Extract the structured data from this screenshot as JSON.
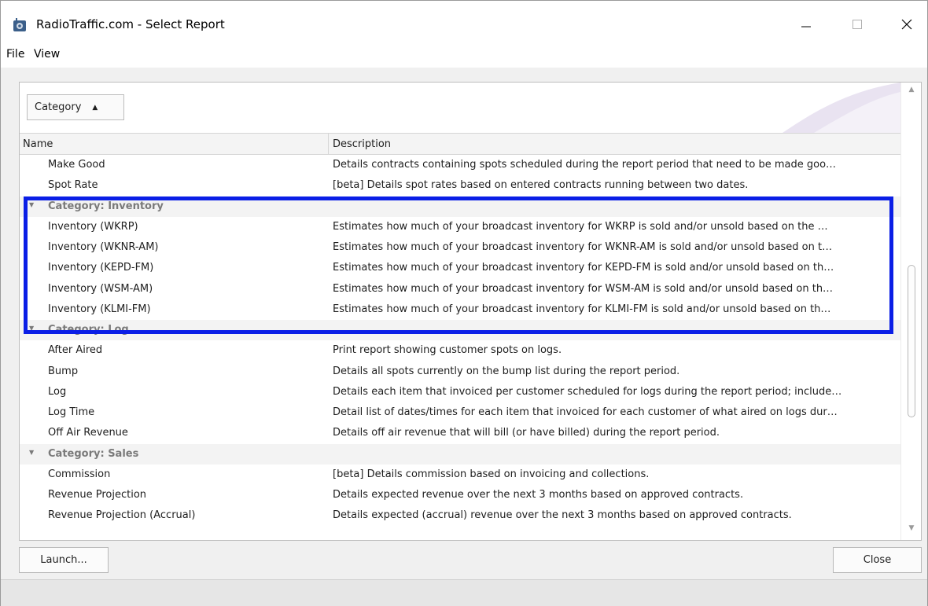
{
  "window": {
    "title": "RadioTraffic.com - Select Report",
    "app_icon": "radio-tower-icon"
  },
  "menu": {
    "file": "File",
    "view": "View"
  },
  "group_panel": {
    "chip_label": "Category",
    "chip_sort": "▲"
  },
  "columns": {
    "name": "Name",
    "description": "Description"
  },
  "rows": [
    {
      "name": "Make Good",
      "description": "Details contracts containing spots scheduled during the report period that need to be made goo…"
    },
    {
      "name": "Spot Rate",
      "description": "[beta] Details spot rates based on entered contracts running between two dates."
    }
  ],
  "groups": [
    {
      "label": "Category: Inventory",
      "rows": [
        {
          "name": "Inventory (WKRP)",
          "description": "Estimates how much of your broadcast inventory for WKRP is sold and/or unsold based on the …"
        },
        {
          "name": "Inventory (WKNR-AM)",
          "description": "Estimates how much of your broadcast inventory for WKNR-AM is sold and/or unsold based on t…"
        },
        {
          "name": "Inventory (KEPD-FM)",
          "description": "Estimates how much of your broadcast inventory for KEPD-FM is sold and/or unsold based on th…"
        },
        {
          "name": "Inventory (WSM-AM)",
          "description": "Estimates how much of your broadcast inventory for WSM-AM is sold and/or unsold based on th…"
        },
        {
          "name": "Inventory (KLMI-FM)",
          "description": "Estimates how much of your broadcast inventory for KLMI-FM is sold and/or unsold based on th…"
        }
      ]
    },
    {
      "label": "Category: Log",
      "rows": [
        {
          "name": "After Aired",
          "description": "Print report showing customer spots on logs."
        },
        {
          "name": "Bump",
          "description": "Details all spots currently on the bump list during the report period."
        },
        {
          "name": "Log",
          "description": "Details each item that invoiced per customer scheduled for logs during the report period; include…"
        },
        {
          "name": "Log Time",
          "description": "Detail list of dates/times for each item that invoiced for each customer of what aired on logs dur…"
        },
        {
          "name": "Off Air Revenue",
          "description": "Details off air revenue that will bill (or have billed) during the report period."
        }
      ]
    },
    {
      "label": "Category: Sales",
      "rows": [
        {
          "name": "Commission",
          "description": "[beta] Details commission based on invoicing and collections."
        },
        {
          "name": "Revenue Projection",
          "description": "Details expected revenue over the next 3 months based on approved contracts."
        },
        {
          "name": "Revenue Projection (Accrual)",
          "description": "Details expected (accrual) revenue over the next 3 months based on approved contracts."
        }
      ]
    }
  ],
  "buttons": {
    "launch": "Launch...",
    "close": "Close"
  },
  "colors": {
    "highlight": "#0a1ee6",
    "group_text": "#7a7a7a"
  }
}
